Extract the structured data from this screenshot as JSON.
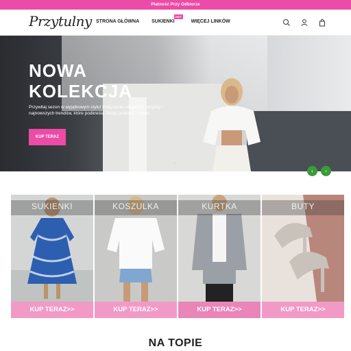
{
  "topbar": {
    "text": "Płatność Przy Odbiorze"
  },
  "header": {
    "logo": "Przytulny",
    "nav": [
      {
        "label": "STRONA GŁÓWNA"
      },
      {
        "label": "SUKIENKI",
        "badge": "HOT"
      },
      {
        "label": "WIĘCEJ LINKÓW"
      }
    ],
    "icons": [
      "search-icon",
      "account-icon",
      "cart-icon"
    ]
  },
  "hero": {
    "title_line1": "NOWA",
    "title_line2": "KOLEKCJA",
    "description": "Przywitaj sezon w wyjątkowym stylu! Połączenie elegancji, wygody i najnowszych trendów, które podkreślą Twoją pewność siebie!",
    "button": "KUP TERAZ",
    "prev": "‹",
    "next": "›"
  },
  "categories": [
    {
      "label": "SUKIENKI",
      "button": "KUP TERAZ>>"
    },
    {
      "label": "KOSZULKA",
      "button": "KUP TERAZ>>"
    },
    {
      "label": "KURTKA",
      "button": "KUP TERAZ>>"
    },
    {
      "label": "BUTY",
      "button": "KUP TERAZ>>"
    }
  ],
  "section": {
    "title": "NA TOPIE"
  },
  "colors": {
    "accent": "#ec4ba7",
    "card_button": "#f29ac6",
    "slider_arrow": "#3a9b3a"
  }
}
